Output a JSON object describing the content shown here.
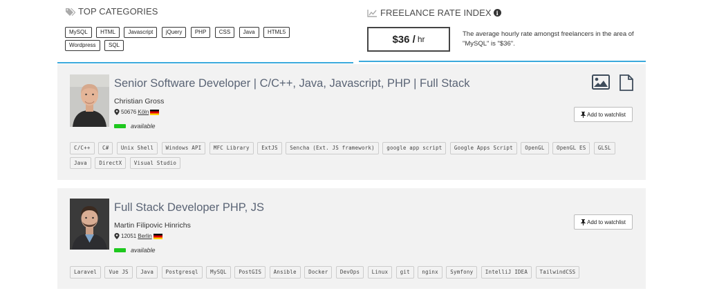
{
  "top_categories": {
    "title": "TOP CATEGORIES",
    "tags": [
      "MySQL",
      "HTML",
      "Javascript",
      "jQuery",
      "PHP",
      "CSS",
      "Java",
      "HTML5",
      "Wordpress",
      "SQL"
    ]
  },
  "rate_index": {
    "title": "FREELANCE RATE INDEX",
    "amount": "$36 /",
    "unit": "hr",
    "description_line1": "The average hourly rate amongst freelancers in the area of",
    "description_line2": "\"MySQL\" is \"$36\"."
  },
  "profiles": [
    {
      "title": "Senior Software Developer | C/C++, Java, Javascript, PHP | Full Stack",
      "name": "Christian Gross",
      "zip": "50676",
      "city": "Köln",
      "status": "available",
      "watch_label": "Add to watchlist",
      "skills": [
        "C/C++",
        "C#",
        "Unix Shell",
        "Windows API",
        "MFC Library",
        "ExtJS",
        "Sencha (Ext. JS framework)",
        "google app script",
        "Google Apps Script",
        "OpenGL",
        "OpenGL ES",
        "GLSL",
        "Java",
        "DirectX",
        "Visual Studio"
      ]
    },
    {
      "title": "Full Stack Developer PHP, JS",
      "name": "Martin Filipovic Hinrichs",
      "zip": "12051",
      "city": "Berlin",
      "status": "available",
      "watch_label": "Add to watchlist",
      "skills": [
        "Laravel",
        "Vue JS",
        "Java",
        "Postgresql",
        "MySQL",
        "PostGIS",
        "Ansible",
        "Docker",
        "DevOps",
        "Linux",
        "git",
        "nginx",
        "Symfony",
        "IntelliJ IDEA",
        "TailwindCSS"
      ]
    }
  ],
  "icons": {
    "tags": "tags-icon",
    "chart": "line-chart-icon",
    "info": "info-circle-icon",
    "pin": "map-pin-icon",
    "image": "image-icon",
    "document": "document-icon",
    "thumbtack": "thumbtack-icon",
    "flag": "germany-flag-icon"
  },
  "colors": {
    "accent_line": "#3aa9dc",
    "available": "#1ec81e",
    "card_bg": "#f2f2f2"
  }
}
